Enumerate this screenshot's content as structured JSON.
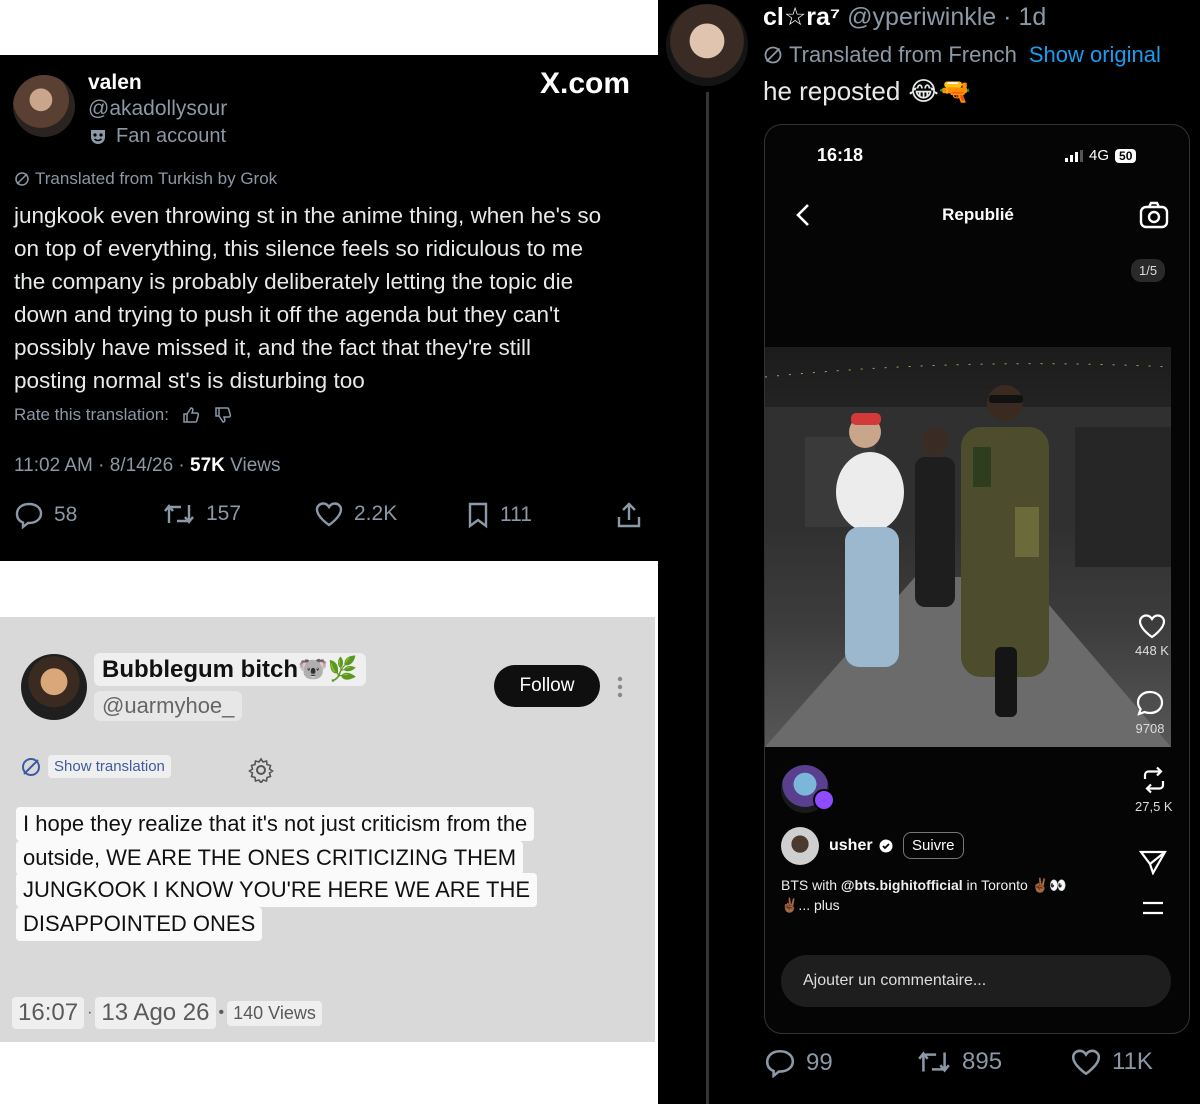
{
  "tweet1": {
    "name": "valen",
    "handle": "@akadollysour",
    "fan_label": "Fan account",
    "brand": "X.com",
    "translated": "Translated from Turkish by Grok",
    "body_lines": [
      "jungkook even throwing st in the anime thing, when he's so",
      "on top of everything, this silence feels so ridiculous to me",
      "the company is probably deliberately letting the topic die",
      "down and trying to push it off the agenda but they can't",
      "possibly have missed it, and the fact that they're still",
      "posting normal st's is disturbing too"
    ],
    "rate_label": "Rate this translation:",
    "meta_time": "11:02 AM · 8/14/26 · ",
    "views_count": "57K",
    "views_label": " Views",
    "replies": "58",
    "reposts": "157",
    "likes": "2.2K",
    "bookmarks": "111",
    "icons": [
      "mask-icon",
      "translate-icon",
      "thumbs-up-icon",
      "thumbs-down-icon",
      "reply-icon",
      "repost-icon",
      "heart-icon",
      "bookmark-icon",
      "share-icon"
    ]
  },
  "tweet2": {
    "name": "Bubblegum bitch🐨🌿",
    "handle": "@uarmyhoe_",
    "follow_label": "Follow",
    "show_translation": "Show translation",
    "body_lines": [
      "I hope they realize that it's not just criticism from the",
      "outside, WE ARE THE ONES CRITICIZING THEM",
      "JUNGKOOK I KNOW YOU'RE HERE WE ARE THE",
      "DISAPPOINTED ONES"
    ],
    "time": "16:07",
    "sep1": "·",
    "date": "13 Ago 26",
    "sep2": "•",
    "views": "140 Views"
  },
  "tweet3": {
    "name": "cl☆ra⁷",
    "handle": "@yperiwinkle",
    "age": "· 1d",
    "translated": "Translated from French",
    "show_original": "Show original",
    "body": "he reposted",
    "body_emoji": "😂🔫",
    "replies": "99",
    "reposts": "895",
    "likes": "11K",
    "phone": {
      "time": "16:18",
      "network": "4G",
      "battery": "50",
      "title": "Republié",
      "page": "1/5",
      "likes": "448 K",
      "comments": "9708",
      "reposts": "27,5 K",
      "username": "usher",
      "follow_label": "Suivre",
      "caption_prefix": "BTS with ",
      "caption_tag": "@bts.bighitofficial",
      "caption_mid": " in Toronto ",
      "caption_emoji": "✌🏾👀",
      "caption_line2": "✌🏾... plus",
      "comment_placeholder": "Ajouter un commentaire..."
    }
  }
}
